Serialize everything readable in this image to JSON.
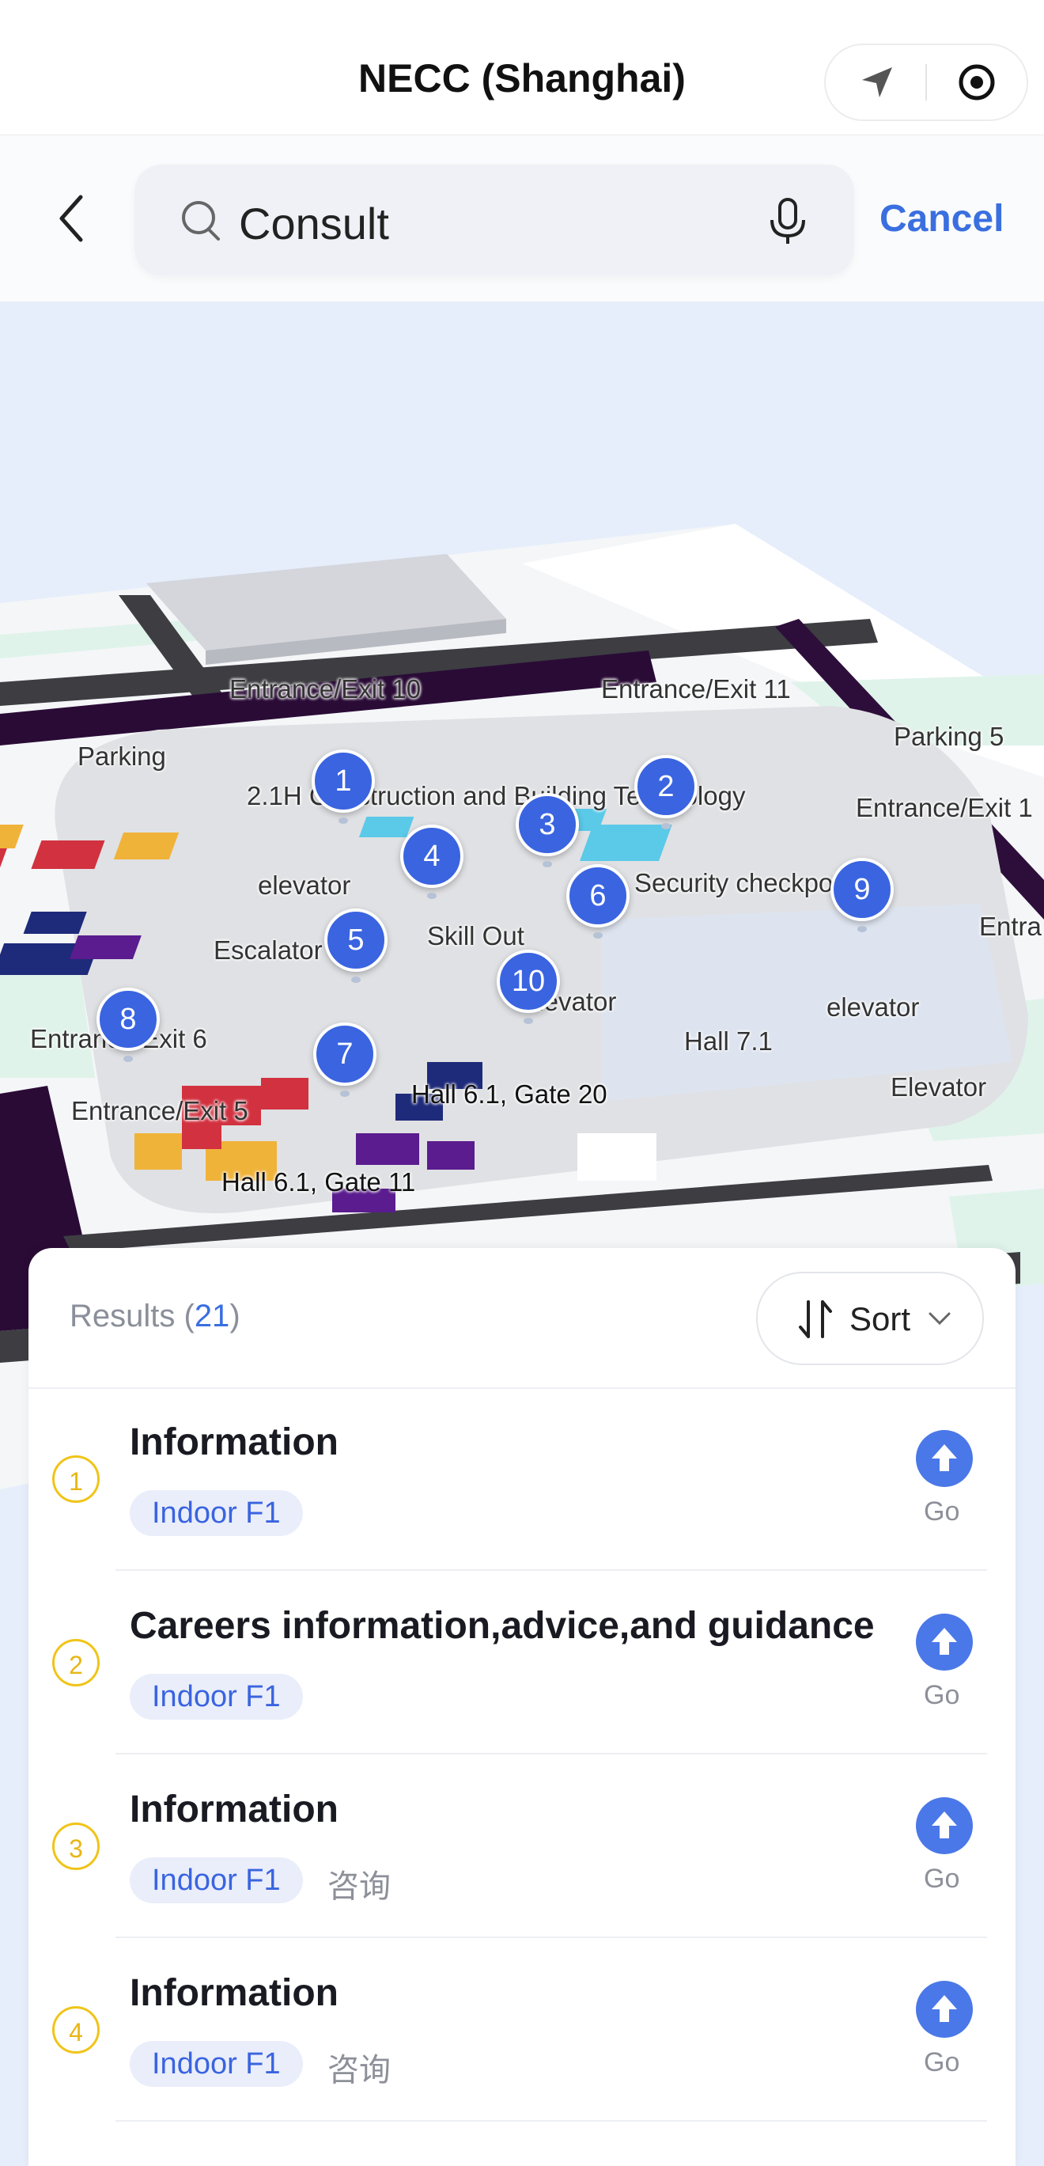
{
  "header": {
    "title": "NECC (Shanghai)"
  },
  "search": {
    "query": "Consult",
    "cancel_label": "Cancel"
  },
  "map": {
    "labels": [
      "Entrance/Exit 10",
      "Entrance/Exit 11",
      "Parking",
      "Parking 5",
      "Entrance/Exit 1",
      "2.1H Construction and Building Technology",
      "Security checkpoint",
      "elevator",
      "Escalator",
      "Skill Out",
      "elevator",
      "elevator",
      "Hall 7.1",
      "Entrance/Exit 6",
      "Entrance/Exit 5",
      "Elevator",
      "Hall 6.1, Gate 20",
      "Hall 6.1, Gate 11",
      "Entra"
    ],
    "pins": [
      "1",
      "2",
      "3",
      "4",
      "5",
      "6",
      "7",
      "8",
      "9",
      "10"
    ]
  },
  "results": {
    "label": "Results (",
    "count": "21",
    "close": ")",
    "sort_label": "Sort",
    "items": [
      {
        "num": "1",
        "name": "Information",
        "tag": "Indoor F1",
        "sub": "",
        "go": "Go"
      },
      {
        "num": "2",
        "name": "Careers information,advice,and guidance",
        "tag": "Indoor F1",
        "sub": "",
        "go": "Go"
      },
      {
        "num": "3",
        "name": "Information",
        "tag": "Indoor F1",
        "sub": "咨询",
        "go": "Go"
      },
      {
        "num": "4",
        "name": "Information",
        "tag": "Indoor F1",
        "sub": "咨询",
        "go": "Go"
      }
    ]
  },
  "colors": {
    "accent": "#3a6fe0",
    "pin": "#3a64e0",
    "rank": "#f0c419"
  }
}
